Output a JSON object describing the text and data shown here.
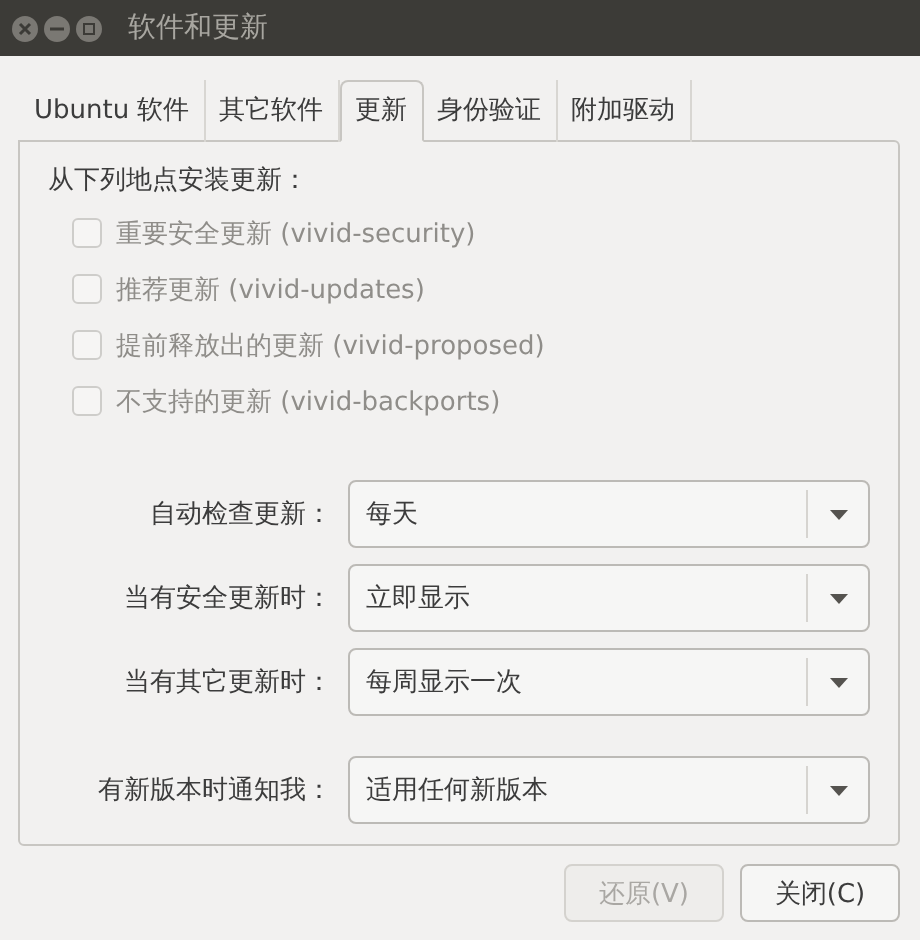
{
  "window": {
    "title": "软件和更新"
  },
  "tabs": [
    {
      "label": "Ubuntu 软件",
      "selected": false
    },
    {
      "label": "其它软件",
      "selected": false
    },
    {
      "label": "更新",
      "selected": true
    },
    {
      "label": "身份验证",
      "selected": false
    },
    {
      "label": "附加驱动",
      "selected": false
    }
  ],
  "sources": {
    "heading": "从下列地点安装更新：",
    "items": [
      {
        "label": "重要安全更新 (vivid-security)",
        "checked": false,
        "disabled": true
      },
      {
        "label": "推荐更新 (vivid-updates)",
        "checked": false,
        "disabled": true
      },
      {
        "label": "提前释放出的更新 (vivid-proposed)",
        "checked": false,
        "disabled": true
      },
      {
        "label": "不支持的更新 (vivid-backports)",
        "checked": false,
        "disabled": true
      }
    ]
  },
  "schedule": [
    {
      "label": "自动检查更新：",
      "value": "每天"
    },
    {
      "label": "当有安全更新时：",
      "value": "立即显示"
    },
    {
      "label": "当有其它更新时：",
      "value": "每周显示一次"
    }
  ],
  "notify": [
    {
      "label": "有新版本时通知我：",
      "value": "适用任何新版本"
    }
  ],
  "buttons": [
    {
      "label": "还原(V)",
      "disabled": true
    },
    {
      "label": "关闭(C)",
      "disabled": false
    }
  ]
}
